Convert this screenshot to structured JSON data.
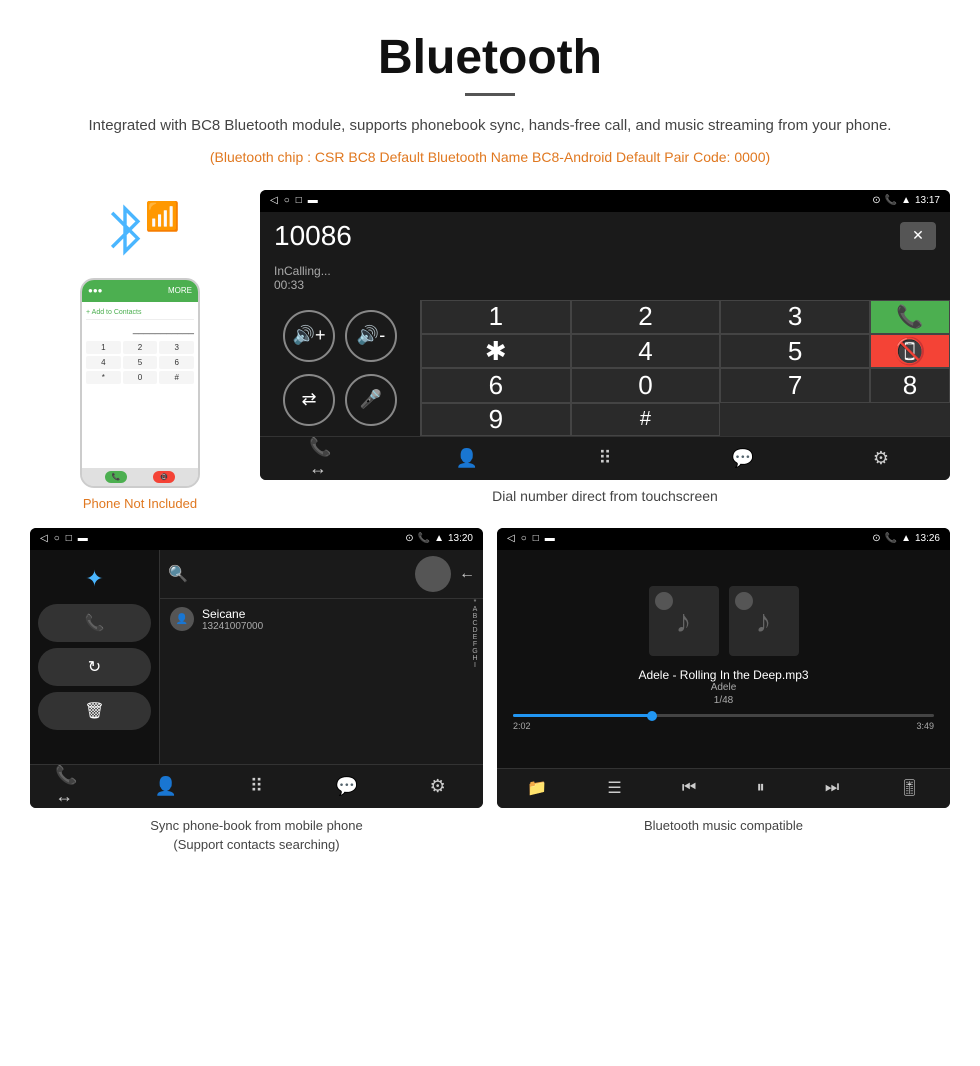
{
  "header": {
    "title": "Bluetooth",
    "description": "Integrated with BC8 Bluetooth module, supports phonebook sync, hands-free call, and music streaming from your phone.",
    "specs": "(Bluetooth chip : CSR BC8    Default Bluetooth Name BC8-Android    Default Pair Code: 0000)"
  },
  "dial_screen": {
    "status_time": "13:17",
    "number": "10086",
    "call_state": "InCalling...",
    "duration": "00:33",
    "keypad": [
      "1",
      "2",
      "3",
      "*",
      "4",
      "5",
      "6",
      "0",
      "7",
      "8",
      "9",
      "#"
    ],
    "caption": "Dial number direct from touchscreen"
  },
  "phonebook_screen": {
    "contact_name": "Seicane",
    "contact_number": "13241007000",
    "status_time": "13:20",
    "alpha": [
      "*",
      "A",
      "B",
      "C",
      "D",
      "E",
      "F",
      "G",
      "H",
      "I"
    ],
    "caption_line1": "Sync phone-book from mobile phone",
    "caption_line2": "(Support contacts searching)"
  },
  "music_screen": {
    "status_time": "13:26",
    "song": "Adele - Rolling In the Deep.mp3",
    "artist": "Adele",
    "track": "1/48",
    "time_current": "2:02",
    "time_total": "3:49",
    "progress": 33,
    "caption": "Bluetooth music compatible"
  },
  "phone_not_included": "Phone Not Included"
}
